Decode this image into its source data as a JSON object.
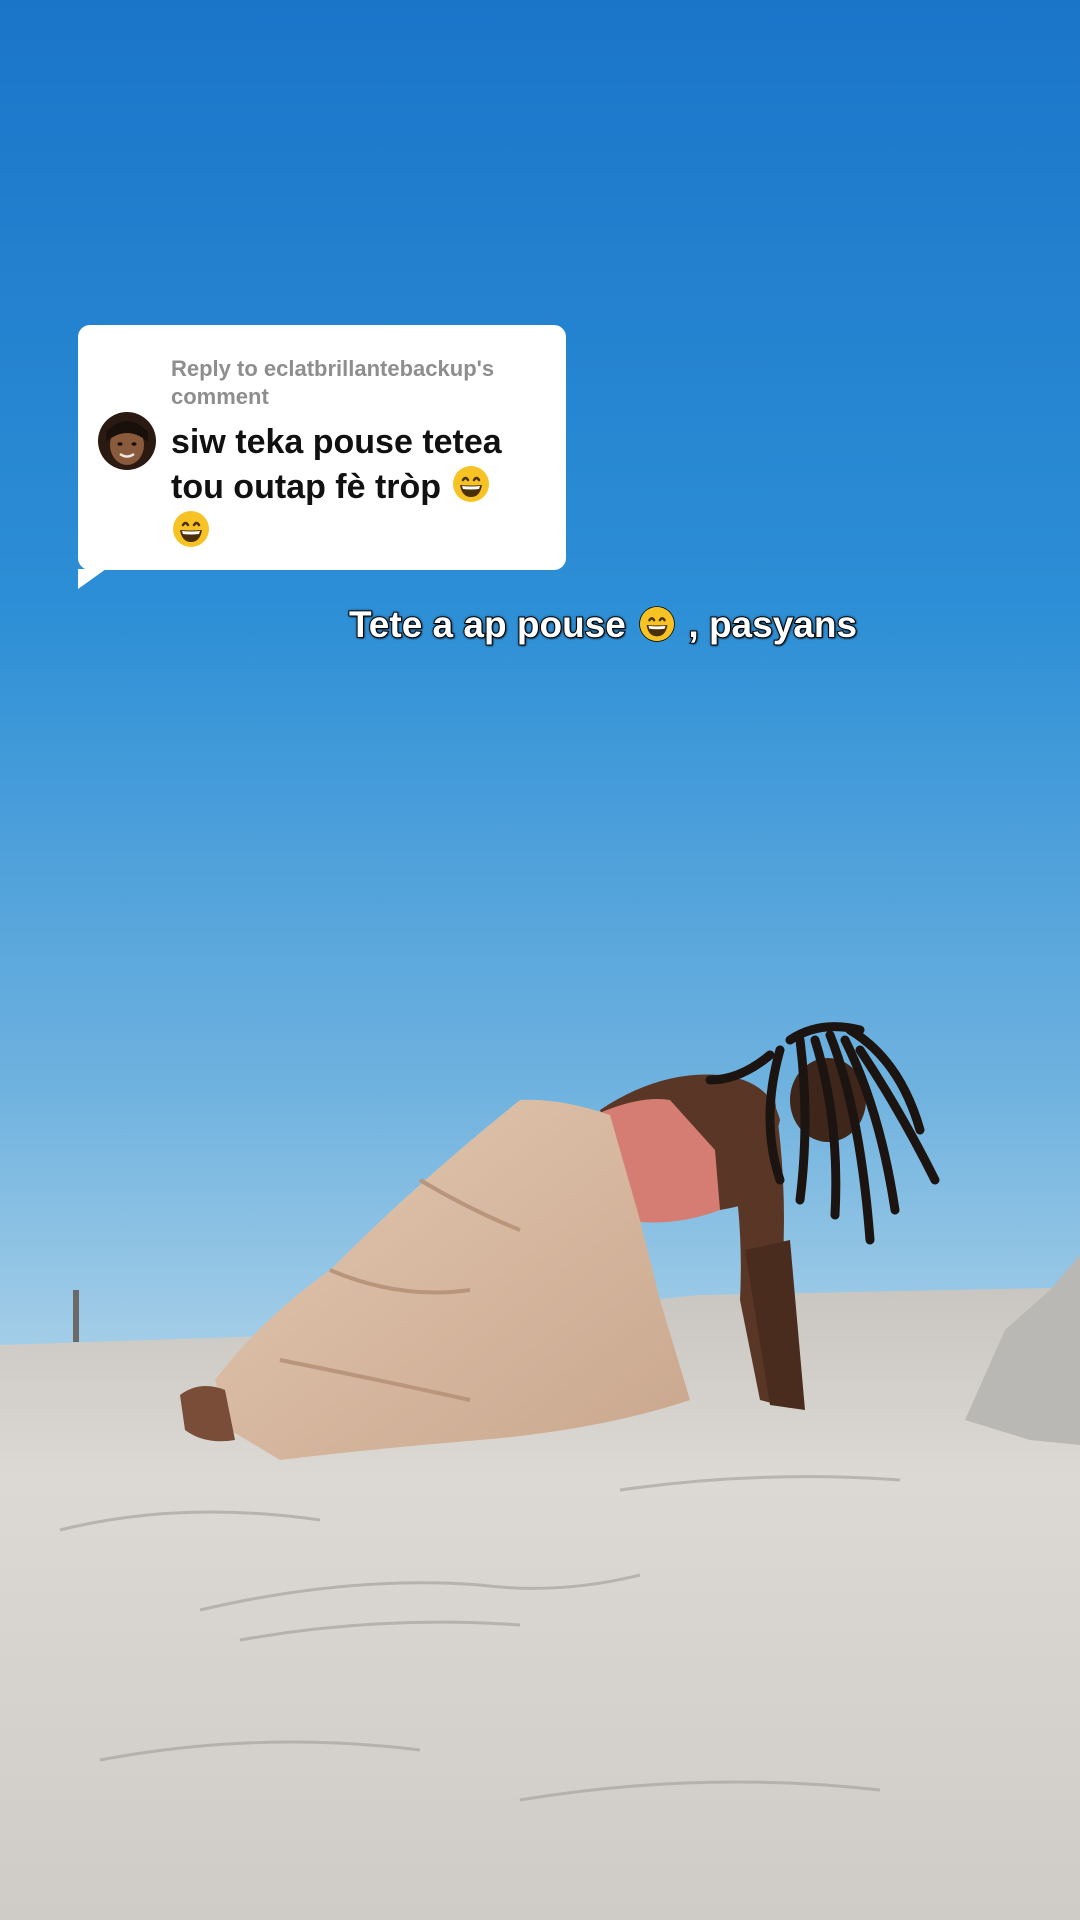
{
  "reply": {
    "header": "Reply to eclatbrillantebackup's comment",
    "text": "siw teka pouse tetea tou outap fè tròp",
    "emoji": "grinning-face-with-smiling-eyes"
  },
  "caption": {
    "before_emoji": "Tete a ap pouse",
    "after_emoji": ", pasyans",
    "emoji": "grinning-face-with-smiling-eyes"
  },
  "colors": {
    "sky_top": "#1e7fd0",
    "sky_bottom": "#8fc3e3",
    "sand": "#d9d6d1",
    "skirt": "#d9bda5",
    "top": "#d57d72",
    "skin": "#5a3626"
  },
  "icons": [
    "commenter-avatar",
    "grinning-face-emoji"
  ]
}
